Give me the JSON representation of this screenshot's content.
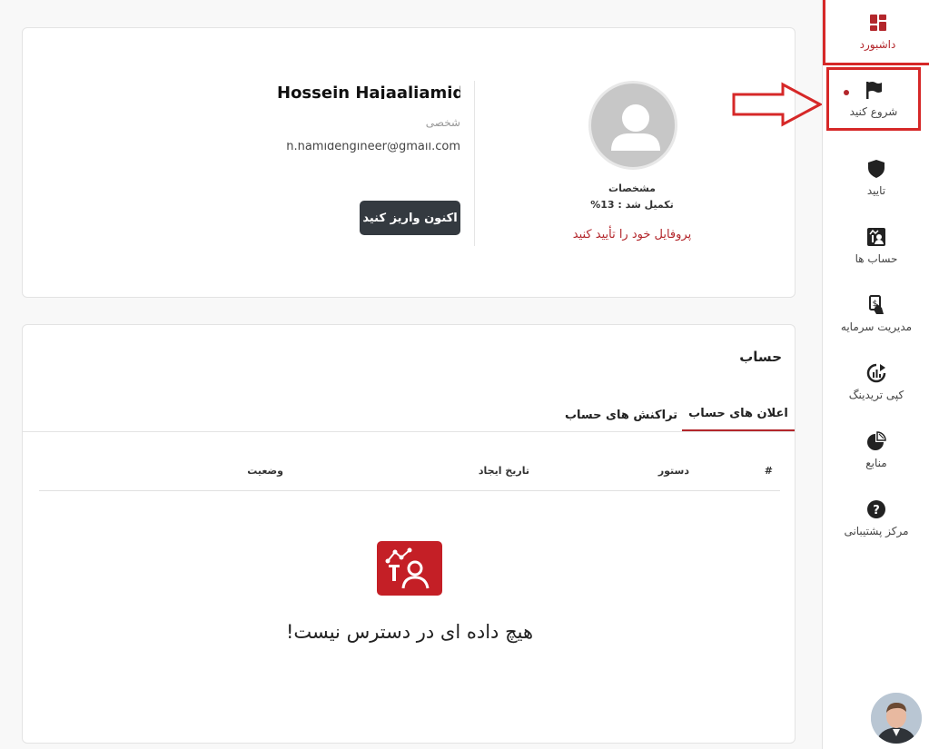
{
  "sidebar": {
    "items": [
      {
        "label": "داشبورد",
        "icon": "dashboard-icon"
      },
      {
        "label": "شروع کنید",
        "icon": "flag-icon"
      },
      {
        "label": "تایید",
        "icon": "shield-icon"
      },
      {
        "label": "حساب ها",
        "icon": "account-chart-icon"
      },
      {
        "label": "مدیریت سرمایه",
        "icon": "money-hand-icon"
      },
      {
        "label": "کپی تریدینگ",
        "icon": "copy-trading-icon"
      },
      {
        "label": "منابع",
        "icon": "pie-chart-icon"
      },
      {
        "label": "مرکز پشتیبانی",
        "icon": "question-icon"
      }
    ],
    "accent_color": "#b3262b"
  },
  "profile": {
    "name": "Hossein Hajaaliamid",
    "type": "شخصی",
    "email": "h.hamidengineer@gmail.com",
    "deposit_button": "اکنون واریز کنید",
    "details_label": "مشخصات",
    "completion_label": "تکمیل شد : 13%",
    "completion_percent": 13,
    "verify_link": "پروفایل خود را تأیید کنید"
  },
  "account": {
    "title": "حساب",
    "tabs": [
      "اعلان های حساب",
      "تراکنش های حساب"
    ],
    "active_tab": "اعلان های حساب",
    "columns": [
      "#",
      "دستور",
      "تاریخ ایجاد",
      "وضعیت"
    ],
    "rows": [],
    "empty_message": "هیچ داده ای در دسترس نیست!"
  }
}
